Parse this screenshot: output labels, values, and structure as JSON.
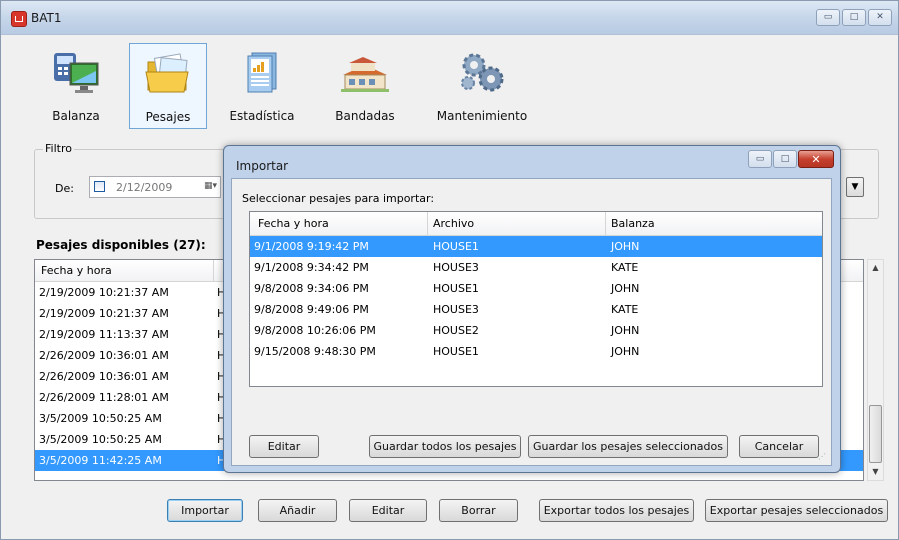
{
  "window": {
    "title": "BAT1",
    "controls": {
      "minimize": "▭",
      "maximize": "□",
      "close": "✕"
    }
  },
  "toolbar": [
    {
      "label": "Balanza",
      "icon": "scale-monitor-icon",
      "active": false
    },
    {
      "label": "Pesajes",
      "icon": "folder-icon",
      "active": true
    },
    {
      "label": "Estadística",
      "icon": "statistics-icon",
      "active": false
    },
    {
      "label": "Bandadas",
      "icon": "farm-building-icon",
      "active": false
    },
    {
      "label": "Mantenimiento",
      "icon": "gears-icon",
      "active": false
    }
  ],
  "filter": {
    "legend": "Filtro",
    "from_label": "De:",
    "from_date": "2/12/2009"
  },
  "available": {
    "title": "Pesajes disponibles (27):",
    "columns": [
      "Fecha y hora",
      ""
    ],
    "rows": [
      {
        "datetime": "2/19/2009 10:21:37 AM",
        "file": "H",
        "selected": false
      },
      {
        "datetime": "2/19/2009 10:21:37 AM",
        "file": "H",
        "selected": false
      },
      {
        "datetime": "2/19/2009 11:13:37 AM",
        "file": "H",
        "selected": false
      },
      {
        "datetime": "2/26/2009 10:36:01 AM",
        "file": "H",
        "selected": false
      },
      {
        "datetime": "2/26/2009 10:36:01 AM",
        "file": "H",
        "selected": false
      },
      {
        "datetime": "2/26/2009 11:28:01 AM",
        "file": "H",
        "selected": false
      },
      {
        "datetime": "3/5/2009 10:50:25 AM",
        "file": "H",
        "selected": false
      },
      {
        "datetime": "3/5/2009 10:50:25 AM",
        "file": "H",
        "selected": false
      },
      {
        "datetime": "3/5/2009 11:42:25 AM",
        "file": "H",
        "selected": true
      }
    ]
  },
  "main_buttons": {
    "import": "Importar",
    "add": "Añadir",
    "edit": "Editar",
    "delete": "Borrar",
    "export_all": "Exportar todos los pesajes",
    "export_selected": "Exportar pesajes seleccionados"
  },
  "dialog": {
    "title": "Importar",
    "instruction": "Seleccionar pesajes para importar:",
    "columns": [
      "Fecha y hora",
      "Archivo",
      "Balanza"
    ],
    "rows": [
      {
        "datetime": "9/1/2008 9:19:42 PM",
        "file": "HOUSE1",
        "scale": "JOHN",
        "selected": true
      },
      {
        "datetime": "9/1/2008 9:34:42 PM",
        "file": "HOUSE3",
        "scale": "KATE",
        "selected": false
      },
      {
        "datetime": "9/8/2008 9:34:06 PM",
        "file": "HOUSE1",
        "scale": "JOHN",
        "selected": false
      },
      {
        "datetime": "9/8/2008 9:49:06 PM",
        "file": "HOUSE3",
        "scale": "KATE",
        "selected": false
      },
      {
        "datetime": "9/8/2008 10:26:06 PM",
        "file": "HOUSE2",
        "scale": "JOHN",
        "selected": false
      },
      {
        "datetime": "9/15/2008 9:48:30 PM",
        "file": "HOUSE1",
        "scale": "JOHN",
        "selected": false
      }
    ],
    "buttons": {
      "edit": "Editar",
      "save_all": "Guardar todos los pesajes",
      "save_selected": "Guardar los pesajes seleccionados",
      "cancel": "Cancelar"
    }
  },
  "colors": {
    "selection": "#3399ff",
    "dialog_frame": "#bfd2ea",
    "window_bg": "#f0f0f0"
  }
}
